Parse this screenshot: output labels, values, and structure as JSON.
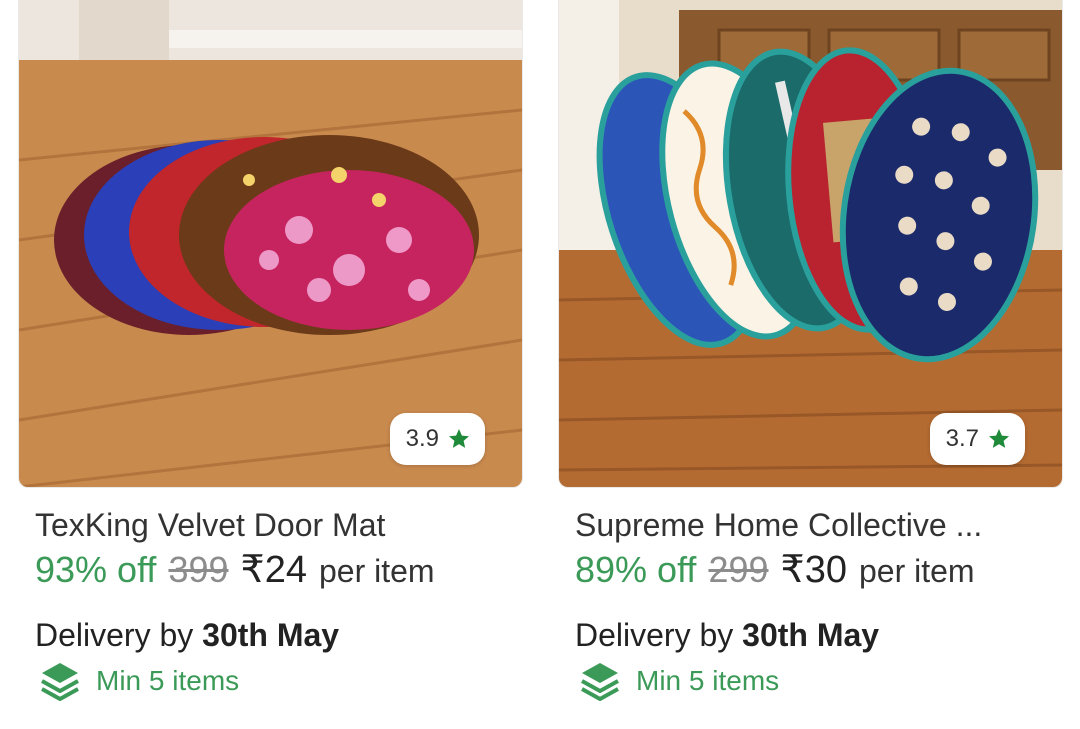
{
  "products": [
    {
      "title": "TexKing Velvet Door Mat",
      "rating": "3.9",
      "discount": "93% off",
      "mrp": "399",
      "price": "₹24",
      "price_suffix": "per item",
      "delivery_prefix": "Delivery by",
      "delivery_date": "30th May",
      "min_items": "Min 5 items",
      "image_icon": "floral-velvet-mats-photo"
    },
    {
      "title": "Supreme Home Collective ...",
      "rating": "3.7",
      "discount": "89% off",
      "mrp": "299",
      "price": "₹30",
      "price_suffix": "per item",
      "delivery_prefix": "Delivery by",
      "delivery_date": "30th May",
      "min_items": "Min 5 items",
      "image_icon": "oval-printed-mats-photo"
    }
  ],
  "colors": {
    "discount_green": "#3b9a57",
    "star_green": "#1f8a3a",
    "strike_gray": "#8c8c8c"
  }
}
